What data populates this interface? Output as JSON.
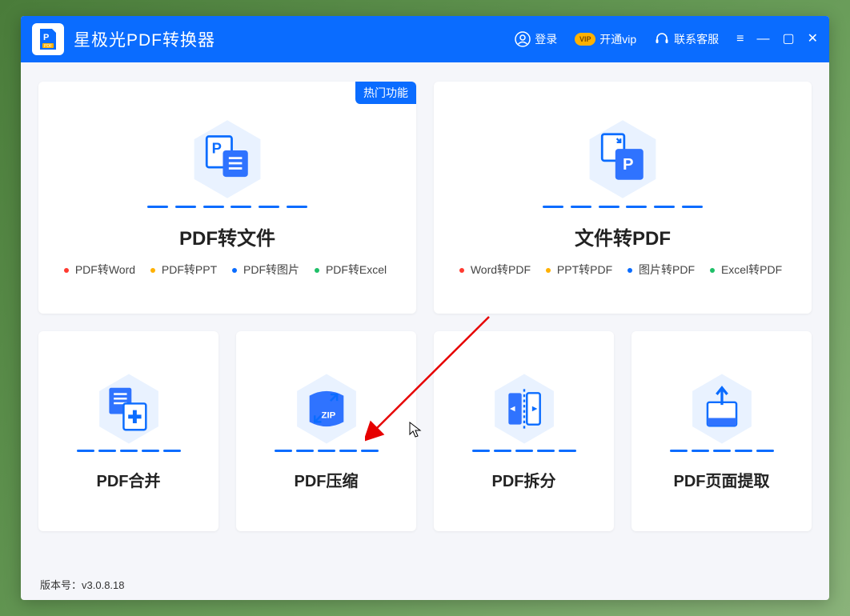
{
  "header": {
    "app_title": "星极光PDF转换器",
    "login_label": "登录",
    "vip_pill": "VIP",
    "vip_label": "开通vip",
    "contact_label": "联系客服"
  },
  "main": {
    "hot_badge": "热门功能",
    "card_pdf_to_file": {
      "title": "PDF转文件",
      "items": [
        "PDF转Word",
        "PDF转PPT",
        "PDF转图片",
        "PDF转Excel"
      ]
    },
    "card_file_to_pdf": {
      "title": "文件转PDF",
      "items": [
        "Word转PDF",
        "PPT转PDF",
        "图片转PDF",
        "Excel转PDF"
      ]
    },
    "card_merge": {
      "title": "PDF合并"
    },
    "card_compress": {
      "title": "PDF压缩",
      "zip_label": "ZIP"
    },
    "card_split": {
      "title": "PDF拆分"
    },
    "card_extract": {
      "title": "PDF页面提取"
    }
  },
  "footer": {
    "version_prefix": "版本号：",
    "version": "v3.0.8.18"
  }
}
